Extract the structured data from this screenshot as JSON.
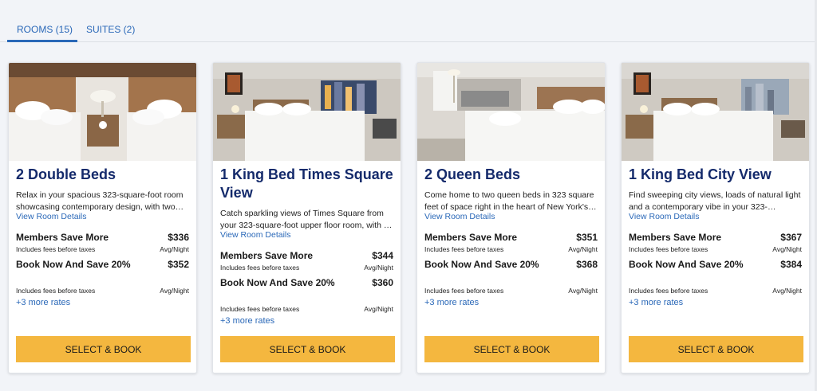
{
  "tabs": [
    {
      "label": "ROOMS (15)"
    },
    {
      "label": "SUITES (2)"
    }
  ],
  "colors": {
    "accent": "#2a68b8",
    "title": "#142a6b",
    "button": "#f4b73f"
  },
  "cards": [
    {
      "title": "2 Double Beds",
      "description": "Relax in your spacious 323-square-foot room showcasing contemporary design, with two…",
      "details_link": "View Room Details",
      "rates": [
        {
          "name": "Members Save More",
          "price": "$336",
          "fees": "Includes fees before taxes",
          "unit": "Avg/Night"
        },
        {
          "name": "Book Now And Save 20%",
          "price": "$352",
          "fees": "Includes fees before taxes",
          "unit": "Avg/Night"
        }
      ],
      "more_rates": "+3 more rates",
      "button": "SELECT & BOOK"
    },
    {
      "title": "1 King Bed Times Square View",
      "description": "Catch sparkling views of Times Square from your 323-square-foot upper floor room, with …",
      "details_link": "View Room Details",
      "rates": [
        {
          "name": "Members Save More",
          "price": "$344",
          "fees": "Includes fees before taxes",
          "unit": "Avg/Night"
        },
        {
          "name": "Book Now And Save 20%",
          "price": "$360",
          "fees": "Includes fees before taxes",
          "unit": "Avg/Night"
        }
      ],
      "more_rates": "+3 more rates",
      "button": "SELECT & BOOK"
    },
    {
      "title": "2 Queen Beds",
      "description": "Come home to two queen beds in 323 square feet of space right in the heart of New York's…",
      "details_link": "View Room Details",
      "rates": [
        {
          "name": "Members Save More",
          "price": "$351",
          "fees": "Includes fees before taxes",
          "unit": "Avg/Night"
        },
        {
          "name": "Book Now And Save 20%",
          "price": "$368",
          "fees": "Includes fees before taxes",
          "unit": "Avg/Night"
        }
      ],
      "more_rates": "+3 more rates",
      "button": "SELECT & BOOK"
    },
    {
      "title": "1 King Bed City View",
      "description": "Find sweeping city views, loads of natural light and a contemporary vibe in your 323-square-…",
      "details_link": "View Room Details",
      "rates": [
        {
          "name": "Members Save More",
          "price": "$367",
          "fees": "Includes fees before taxes",
          "unit": "Avg/Night"
        },
        {
          "name": "Book Now And Save 20%",
          "price": "$384",
          "fees": "Includes fees before taxes",
          "unit": "Avg/Night"
        }
      ],
      "more_rates": "+3 more rates",
      "button": "SELECT & BOOK"
    }
  ]
}
